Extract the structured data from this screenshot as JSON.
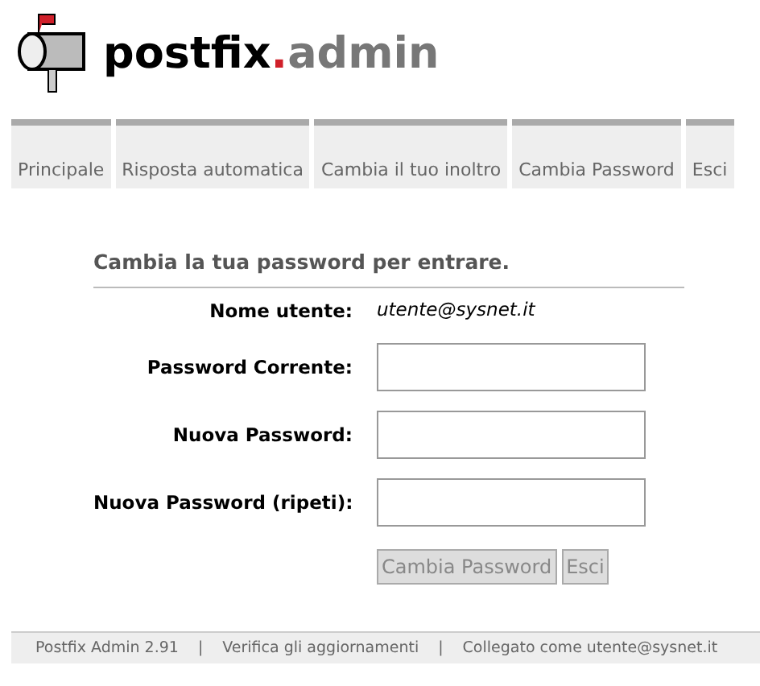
{
  "logo": {
    "name": "postfix",
    "dot": ".",
    "suffix": "admin"
  },
  "tabs": [
    {
      "label": "Principale"
    },
    {
      "label": "Risposta automatica"
    },
    {
      "label": "Cambia il tuo inoltro"
    },
    {
      "label": "Cambia Password"
    },
    {
      "label": "Esci"
    }
  ],
  "form": {
    "title": "Cambia la tua password per entrare.",
    "fields": [
      {
        "kind": "text",
        "label": "Nome utente:",
        "value": "utente@sysnet.it"
      },
      {
        "kind": "input",
        "label": "Password Corrente:"
      },
      {
        "kind": "input",
        "label": "Nuova Password:"
      },
      {
        "kind": "input",
        "label": "Nuova Password (ripeti):"
      }
    ],
    "buttons": [
      "Cambia Password",
      "Esci"
    ]
  },
  "footer": {
    "version": "Postfix Admin 2.91",
    "separator_1": "|",
    "update_link": "Verifica gli aggiornamenti",
    "separator_2": "|",
    "logged_in": "Collegato come utente@sysnet.it"
  }
}
